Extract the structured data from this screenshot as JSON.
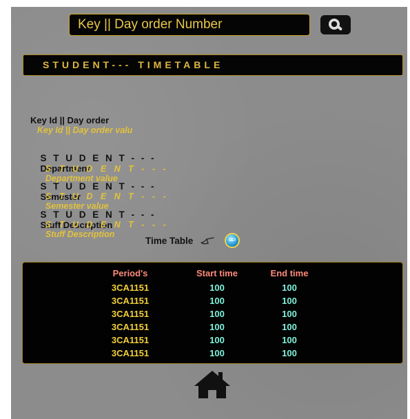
{
  "search": {
    "value": "Key || Day order Number",
    "icon": "search-icon"
  },
  "header": {
    "title": "STUDENT--- TIMETABLE"
  },
  "fields": {
    "key_label": "Key Id || Day order",
    "key_value": "Key Id || Day order valu",
    "dept_prefix": "S T U D E N T - - -",
    "dept_label": "Department",
    "dept_value_prefix": "S T U D E N T - - -",
    "dept_value": "Department value",
    "sem_prefix": "S T U D E N T - - -",
    "sem_label": "Semester",
    "sem_value_prefix": "S T U D E N T - - -",
    "sem_value": "Semester value",
    "stuff_prefix": "S T U D E N T - - -",
    "stuff_label": "Stuff Description",
    "stuff_value_prefix": "S T U D E N T - - -",
    "stuff_value": "Stuff Description"
  },
  "timetable_toggle": {
    "label": "Time Table",
    "pointer_icon": "pointing-hand-icon",
    "button_text": "GET",
    "button_icon": "get-button-icon"
  },
  "table": {
    "headers": [
      "Period's",
      "Start time",
      "End time"
    ],
    "rows": [
      [
        "3CA1151",
        "100",
        "100"
      ],
      [
        "3CA1151",
        "100",
        "100"
      ],
      [
        "3CA1151",
        "100",
        "100"
      ],
      [
        "3CA1151",
        "100",
        "100"
      ],
      [
        "3CA1151",
        "100",
        "100"
      ],
      [
        "3CA1151",
        "100",
        "100"
      ]
    ]
  },
  "footer": {
    "home_icon": "home-icon"
  },
  "colors": {
    "background": "#8c8c8c",
    "gold": "#e0b840",
    "header_red": "#ff8a7a",
    "period_yellow": "#f1cf3a",
    "value_cyan": "#7ff3dc"
  }
}
